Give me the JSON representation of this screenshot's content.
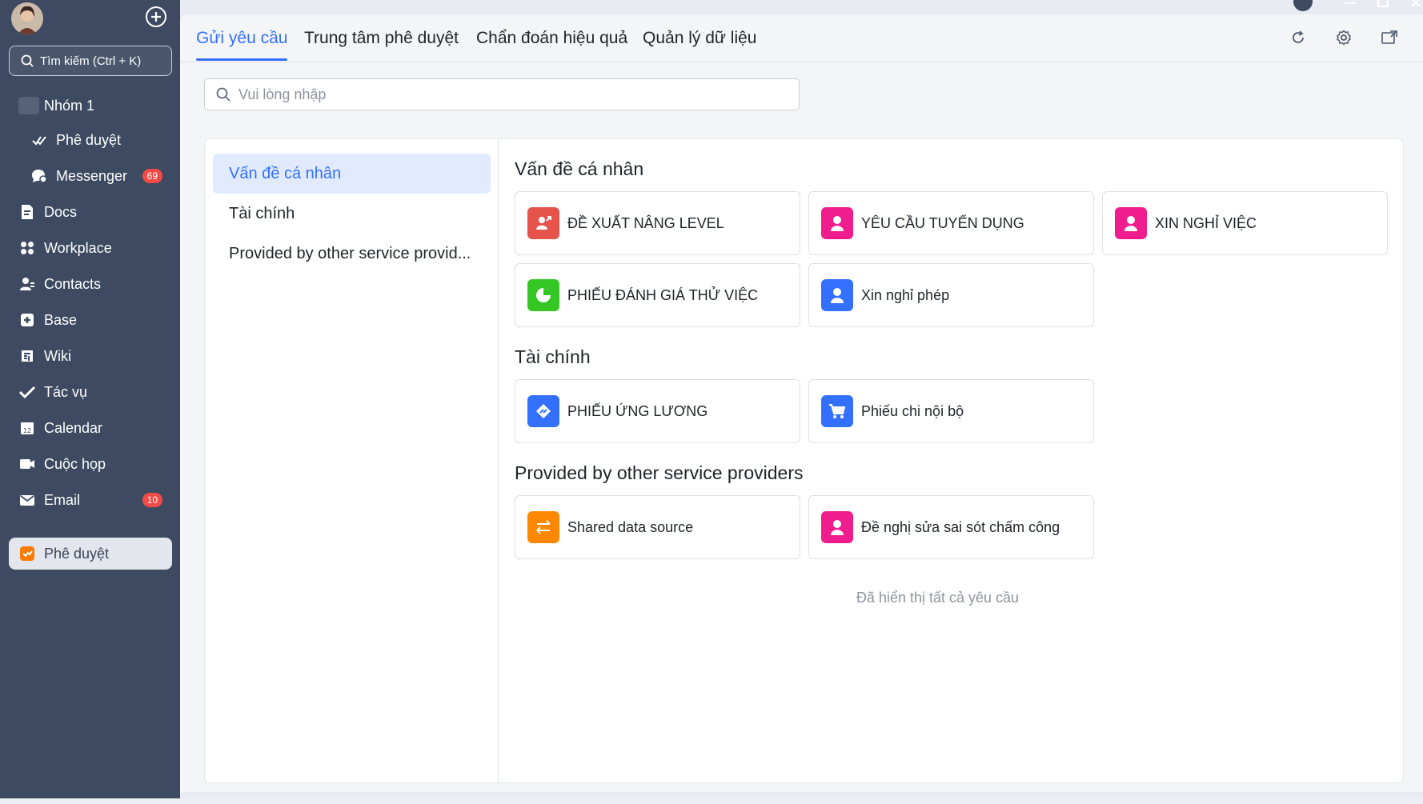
{
  "sidebar": {
    "search_label": "Tìm kiếm (Ctrl + K)",
    "items": [
      {
        "label": "Nhóm 1"
      },
      {
        "label": "Phê duyệt"
      },
      {
        "label": "Messenger",
        "badge": "69"
      },
      {
        "label": "Docs"
      },
      {
        "label": "Workplace"
      },
      {
        "label": "Contacts"
      },
      {
        "label": "Base"
      },
      {
        "label": "Wiki"
      },
      {
        "label": "Tác vụ"
      },
      {
        "label": "Calendar"
      },
      {
        "label": "Cuộc họp"
      },
      {
        "label": "Email",
        "badge": "10"
      },
      {
        "label": "Phê duyệt"
      }
    ]
  },
  "tabs": [
    {
      "label": "Gửi yêu cầu"
    },
    {
      "label": "Trung tâm phê duyệt"
    },
    {
      "label": "Chẩn đoán hiệu quả"
    },
    {
      "label": "Quản lý dữ liệu"
    }
  ],
  "search": {
    "placeholder": "Vui lòng nhập",
    "value": ""
  },
  "categories": [
    {
      "label": "Vấn đề cá nhân"
    },
    {
      "label": "Tài chính"
    },
    {
      "label": "Provided by other service provid..."
    }
  ],
  "sections": [
    {
      "title": "Vấn đề cá nhân",
      "cards": [
        {
          "label": "ĐỀ XUẤT NÂNG LEVEL",
          "icon": "user-arrow-icon",
          "color": "#e5534b"
        },
        {
          "label": "YÊU CẦU TUYỂN DỤNG",
          "icon": "person-icon",
          "color": "#f01d8f"
        },
        {
          "label": "XIN NGHỈ VIỆC",
          "icon": "person-icon",
          "color": "#f01d8f"
        },
        {
          "label": "PHIẾU ĐÁNH GIÁ THỬ VIỆC",
          "icon": "pie-chart-icon",
          "color": "#34c724"
        },
        {
          "label": "Xin nghỉ phép",
          "icon": "person-icon",
          "color": "#3370ff"
        }
      ]
    },
    {
      "title": "Tài chính",
      "cards": [
        {
          "label": "PHIẾU ỨNG LƯƠNG",
          "icon": "transfer-icon",
          "color": "#3370ff"
        },
        {
          "label": "Phiếu chi nội bộ",
          "icon": "cart-icon",
          "color": "#3370ff"
        }
      ]
    },
    {
      "title": "Provided by other service providers",
      "cards": [
        {
          "label": "Shared data source",
          "icon": "swap-icon",
          "color": "#ff8800"
        },
        {
          "label": "Đề nghị sửa sai sót chấm công",
          "icon": "person-icon",
          "color": "#f01d8f"
        }
      ]
    }
  ],
  "footer_note": "Đã hiển thị tất cả yêu cầu"
}
